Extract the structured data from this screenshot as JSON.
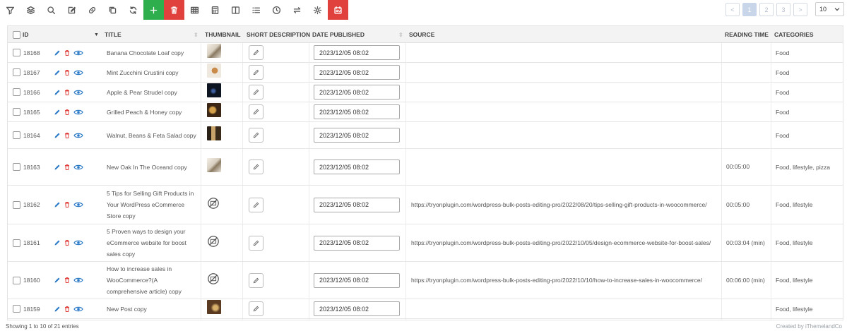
{
  "toolbar": {
    "buttons": [
      "filter-icon",
      "layers-icon",
      "search-icon",
      "edit-icon",
      "link-icon",
      "copy-icon",
      "refresh-icon",
      "add-icon",
      "trash-icon",
      "table-icon",
      "calculator-icon",
      "columns-icon",
      "list-icon",
      "history-icon",
      "swap-icon",
      "gear-icon",
      "bulk-edit-icon"
    ],
    "add_color": "#2fae4e",
    "delete_color": "#e0413d"
  },
  "pagination": {
    "prev": "<",
    "pages": [
      "1",
      "2",
      "3"
    ],
    "next": ">",
    "current": "1",
    "per_page": "10"
  },
  "columns": {
    "id": "ID",
    "title": "TITLE",
    "thumbnail": "THUMBNAIL",
    "short_description": "SHORT DESCRIPTION",
    "date_published": "DATE PUBLISHED",
    "source": "SOURCE",
    "reading_time": "READING TIME",
    "categories": "CATEGORIES"
  },
  "rows": [
    {
      "id": "18168",
      "title": "Banana Chocolate Loaf copy",
      "thumb": "t-light",
      "date": "2023/12/05 08:02",
      "source": "",
      "reading_time": "",
      "categories": "Food"
    },
    {
      "id": "18167",
      "title": "Mint Zucchini Crustini copy",
      "thumb": "t-plate",
      "date": "2023/12/05 08:02",
      "source": "",
      "reading_time": "",
      "categories": "Food"
    },
    {
      "id": "18166",
      "title": "Apple & Pear Strudel copy",
      "thumb": "t-dark",
      "date": "2023/12/05 08:02",
      "source": "",
      "reading_time": "",
      "categories": "Food"
    },
    {
      "id": "18165",
      "title": "Grilled Peach & Honey copy",
      "thumb": "t-food",
      "date": "2023/12/05 08:02",
      "source": "",
      "reading_time": "",
      "categories": "Food"
    },
    {
      "id": "18164",
      "title": "Walnut, Beans & Feta Salad copy",
      "thumb": "t-jar",
      "date": "2023/12/05 08:02",
      "source": "",
      "reading_time": "",
      "categories": "Food"
    },
    {
      "id": "18163",
      "title": "New Oak In The Oceand copy",
      "thumb": "t-light",
      "date": "2023/12/05 08:02",
      "source": "",
      "reading_time": "00:05:00",
      "categories": "Food, lifestyle, pizza"
    },
    {
      "id": "18162",
      "title": "5 Tips for Selling Gift Products in Your WordPress eCommerce Store copy",
      "thumb": "none",
      "date": "2023/12/05 08:02",
      "source": "https://tryonplugin.com/wordpress-bulk-posts-editing-pro/2022/08/20/tips-selling-gift-products-in-woocommerce/",
      "reading_time": "00:05:00",
      "categories": "Food, lifestyle"
    },
    {
      "id": "18161",
      "title": "5 Proven ways to design your eCommerce website for boost sales copy",
      "thumb": "none",
      "date": "2023/12/05 08:02",
      "source": "https://tryonplugin.com/wordpress-bulk-posts-editing-pro/2022/10/05/design-ecommerce-website-for-boost-sales/",
      "reading_time": "00:03:04 (min)",
      "categories": "Food, lifestyle"
    },
    {
      "id": "18160",
      "title": "How to increase sales in WooCommerce?(A comprehensive article) copy",
      "thumb": "none",
      "date": "2023/12/05 08:02",
      "source": "https://tryonplugin.com/wordpress-bulk-posts-editing-pro/2022/10/10/how-to-increase-sales-in-woocommerce/",
      "reading_time": "00:06:00 (min)",
      "categories": "Food, lifestyle"
    },
    {
      "id": "18159",
      "title": "New Post copy",
      "thumb": "t-table",
      "date": "2023/12/05 08:02",
      "source": "",
      "reading_time": "",
      "categories": "Food, lifestyle"
    }
  ],
  "footer": {
    "entries": "Showing 1 to 10 of 21 entries",
    "credit": "Created by iThemelandCo"
  },
  "colors": {
    "accent_blue": "#2a7ac7",
    "delete_red": "#e0413d"
  }
}
